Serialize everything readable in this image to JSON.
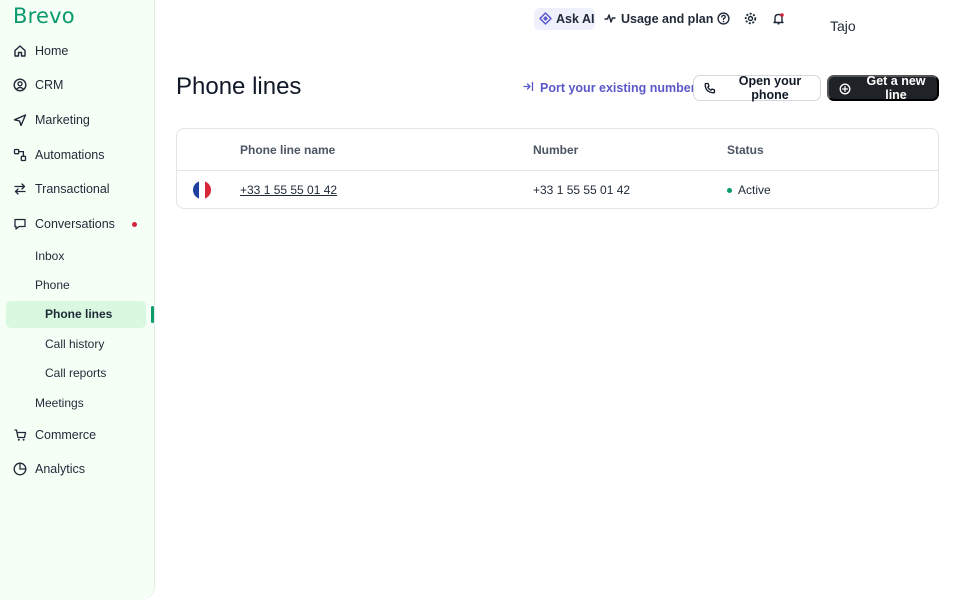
{
  "brand": {
    "logo_text": "Brevo",
    "accent": "#0b996e"
  },
  "sidebar": {
    "items": [
      {
        "label": "Home",
        "icon": "home-icon"
      },
      {
        "label": "CRM",
        "icon": "user-circle-icon"
      },
      {
        "label": "Marketing",
        "icon": "send-icon"
      },
      {
        "label": "Automations",
        "icon": "automation-icon"
      },
      {
        "label": "Transactional",
        "icon": "arrows-icon"
      },
      {
        "label": "Conversations",
        "icon": "chat-icon",
        "has_notification": true
      },
      {
        "label": "Commerce",
        "icon": "cart-icon"
      },
      {
        "label": "Analytics",
        "icon": "pie-chart-icon"
      }
    ],
    "conversations_sub": [
      "Inbox",
      "Phone",
      "Meetings"
    ],
    "phone_sub": [
      "Phone lines",
      "Call history",
      "Call reports"
    ],
    "active_item": "Phone lines"
  },
  "topbar": {
    "ask_ai": "Ask AI",
    "usage": "Usage and plan",
    "user_name": "Tajo"
  },
  "header": {
    "title": "Phone lines",
    "port_link": "Port your existing number",
    "open_phone": "Open your phone",
    "new_line": "Get a new line"
  },
  "table": {
    "columns": [
      "Phone line name",
      "Number",
      "Status"
    ],
    "rows": [
      {
        "flag": "France",
        "name": "+33 1 55 55 01 42",
        "number": "+33 1 55 55 01 42",
        "status": "Active"
      }
    ]
  }
}
